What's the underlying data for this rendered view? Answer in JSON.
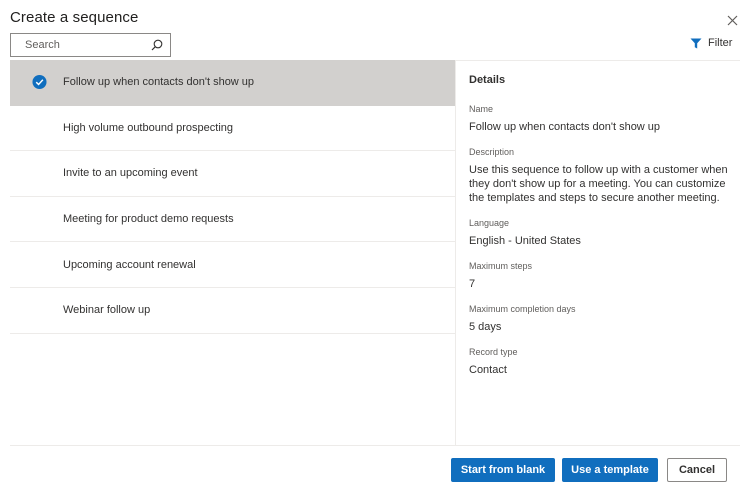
{
  "dialog": {
    "title": "Create a sequence",
    "close_icon": "close-icon"
  },
  "search": {
    "placeholder": "Search",
    "icon": "search-icon"
  },
  "filter": {
    "label": "Filter",
    "icon": "filter-icon"
  },
  "sequences": [
    {
      "label": "Follow up when contacts don't show up",
      "selected": true
    },
    {
      "label": "High volume outbound prospecting",
      "selected": false
    },
    {
      "label": "Invite to an upcoming event",
      "selected": false
    },
    {
      "label": "Meeting for product demo requests",
      "selected": false
    },
    {
      "label": "Upcoming account renewal",
      "selected": false
    },
    {
      "label": "Webinar follow up",
      "selected": false
    }
  ],
  "details": {
    "heading": "Details",
    "name_label": "Name",
    "name_value": "Follow up when contacts don't show up",
    "description_label": "Description",
    "description_value": "Use this sequence to follow up with a customer when they don't show up for a meeting. You can customize the templates and steps to secure another meeting.",
    "language_label": "Language",
    "language_value": "English - United States",
    "max_steps_label": "Maximum steps",
    "max_steps_value": "7",
    "max_days_label": "Maximum completion days",
    "max_days_value": "5 days",
    "record_type_label": "Record type",
    "record_type_value": "Contact"
  },
  "footer": {
    "start_blank_label": "Start from blank",
    "use_template_label": "Use a template",
    "cancel_label": "Cancel"
  },
  "colors": {
    "primary": "#106ebe",
    "selected_row": "#d2d0ce",
    "check": "#106ebe"
  }
}
